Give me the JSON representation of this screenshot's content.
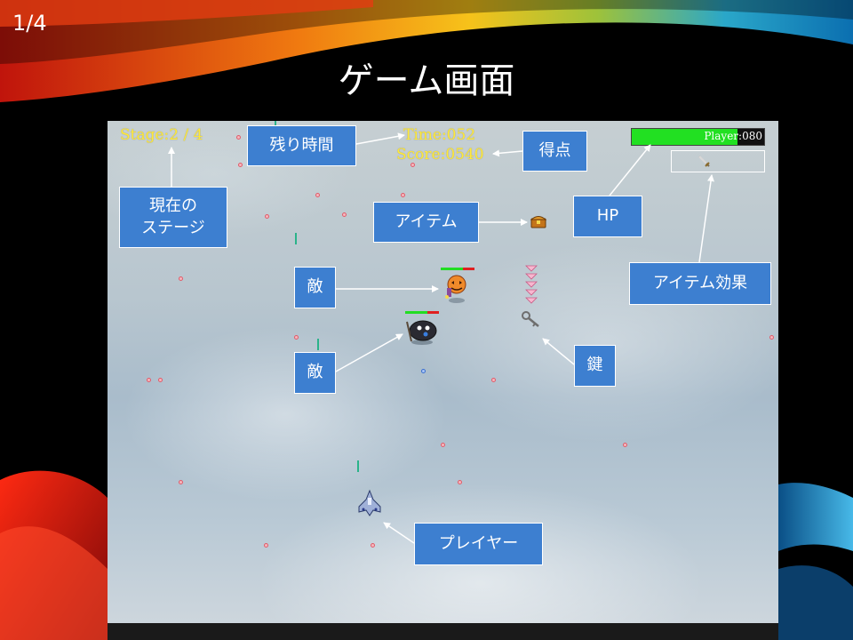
{
  "slide": {
    "page_number": "1/4",
    "title": "ゲーム画面"
  },
  "hud": {
    "stage": "Stage:2 / 4",
    "time": "Time:052",
    "score": "Score:0540",
    "hp_label": "Player:080",
    "hp_fraction": 0.8
  },
  "labels": {
    "remaining_time": "残り時間",
    "score": "得点",
    "current_stage_line1": "現在の",
    "current_stage_line2": "ステージ",
    "item": "アイテム",
    "hp": "HP",
    "item_effect": "アイテム効果",
    "enemy_1": "敵",
    "enemy_2": "敵",
    "key": "鍵",
    "player": "プレイヤー"
  },
  "sprites": [
    "treasure-chest-icon",
    "sword-icon",
    "key-icon",
    "player-ship-icon",
    "enemy-pumpkin-icon",
    "enemy-dark-blob-icon",
    "heart-stack-icon"
  ],
  "colors": {
    "hud_text": "#ffe93a",
    "hp_fill": "#22e022",
    "label_box": "#3d7fd0",
    "enemy_hp_green": "#22dd22",
    "enemy_hp_red": "#e02020"
  }
}
